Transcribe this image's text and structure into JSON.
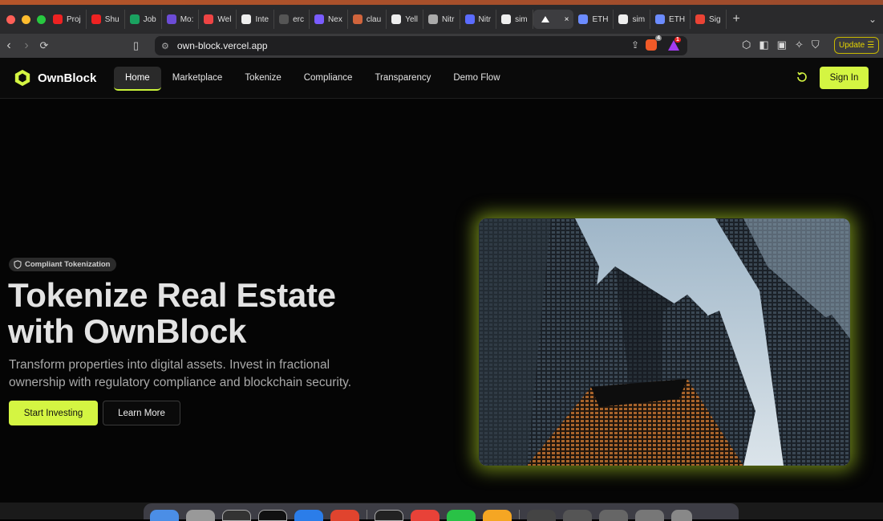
{
  "browser": {
    "tabs": [
      {
        "label": "Proj",
        "color": "#e22"
      },
      {
        "label": "Shu",
        "color": "#e22"
      },
      {
        "label": "Job",
        "color": "#1aa260"
      },
      {
        "label": "Mo:",
        "color": "#6c4cd6"
      },
      {
        "label": "Wel",
        "color": "#e44"
      },
      {
        "label": "Inte",
        "color": "#eee"
      },
      {
        "label": "erc",
        "color": "#555"
      },
      {
        "label": "Nex",
        "color": "#7a5cff"
      },
      {
        "label": "clau",
        "color": "#d0643c"
      },
      {
        "label": "Yell",
        "color": "#eee"
      },
      {
        "label": "Nitr",
        "color": "#aaa"
      },
      {
        "label": "Nitr",
        "color": "#5b6cff"
      },
      {
        "label": "sim",
        "color": "#eee"
      }
    ],
    "active_tab_icon": "vercel-triangle-icon",
    "trailing_tabs": [
      {
        "label": "ETH",
        "color": "#6c8cff"
      },
      {
        "label": "sim",
        "color": "#eee"
      },
      {
        "label": "ETH",
        "color": "#6c8cff"
      },
      {
        "label": "Sig",
        "color": "#ea4335"
      }
    ],
    "url": "own-block.vercel.app",
    "brave_badge": "4",
    "rewards_badge": "1",
    "update_label": "Update"
  },
  "site": {
    "brand": "OwnBlock",
    "accent": "#d4f542",
    "nav": [
      "Home",
      "Marketplace",
      "Tokenize",
      "Compliance",
      "Transparency",
      "Demo Flow"
    ],
    "active_nav": "Home",
    "signin_label": "Sign In"
  },
  "hero": {
    "badge": "Compliant Tokenization",
    "headline_line1": "Tokenize Real Estate",
    "headline_line2": "with OwnBlock",
    "subtext_line1": "Transform properties into digital assets. Invest in fractional",
    "subtext_line2": "ownership with regulatory compliance and blockchain security.",
    "primary_cta": "Start Investing",
    "secondary_cta": "Learn More"
  }
}
